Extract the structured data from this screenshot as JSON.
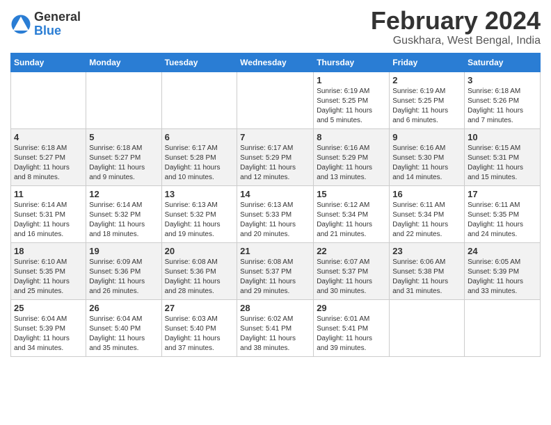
{
  "logo": {
    "general": "General",
    "blue": "Blue"
  },
  "header": {
    "title": "February 2024",
    "subtitle": "Guskhara, West Bengal, India"
  },
  "days_of_week": [
    "Sunday",
    "Monday",
    "Tuesday",
    "Wednesday",
    "Thursday",
    "Friday",
    "Saturday"
  ],
  "weeks": [
    [
      {
        "day": "",
        "info": ""
      },
      {
        "day": "",
        "info": ""
      },
      {
        "day": "",
        "info": ""
      },
      {
        "day": "",
        "info": ""
      },
      {
        "day": "1",
        "info": "Sunrise: 6:19 AM\nSunset: 5:25 PM\nDaylight: 11 hours\nand 5 minutes."
      },
      {
        "day": "2",
        "info": "Sunrise: 6:19 AM\nSunset: 5:25 PM\nDaylight: 11 hours\nand 6 minutes."
      },
      {
        "day": "3",
        "info": "Sunrise: 6:18 AM\nSunset: 5:26 PM\nDaylight: 11 hours\nand 7 minutes."
      }
    ],
    [
      {
        "day": "4",
        "info": "Sunrise: 6:18 AM\nSunset: 5:27 PM\nDaylight: 11 hours\nand 8 minutes."
      },
      {
        "day": "5",
        "info": "Sunrise: 6:18 AM\nSunset: 5:27 PM\nDaylight: 11 hours\nand 9 minutes."
      },
      {
        "day": "6",
        "info": "Sunrise: 6:17 AM\nSunset: 5:28 PM\nDaylight: 11 hours\nand 10 minutes."
      },
      {
        "day": "7",
        "info": "Sunrise: 6:17 AM\nSunset: 5:29 PM\nDaylight: 11 hours\nand 12 minutes."
      },
      {
        "day": "8",
        "info": "Sunrise: 6:16 AM\nSunset: 5:29 PM\nDaylight: 11 hours\nand 13 minutes."
      },
      {
        "day": "9",
        "info": "Sunrise: 6:16 AM\nSunset: 5:30 PM\nDaylight: 11 hours\nand 14 minutes."
      },
      {
        "day": "10",
        "info": "Sunrise: 6:15 AM\nSunset: 5:31 PM\nDaylight: 11 hours\nand 15 minutes."
      }
    ],
    [
      {
        "day": "11",
        "info": "Sunrise: 6:14 AM\nSunset: 5:31 PM\nDaylight: 11 hours\nand 16 minutes."
      },
      {
        "day": "12",
        "info": "Sunrise: 6:14 AM\nSunset: 5:32 PM\nDaylight: 11 hours\nand 18 minutes."
      },
      {
        "day": "13",
        "info": "Sunrise: 6:13 AM\nSunset: 5:32 PM\nDaylight: 11 hours\nand 19 minutes."
      },
      {
        "day": "14",
        "info": "Sunrise: 6:13 AM\nSunset: 5:33 PM\nDaylight: 11 hours\nand 20 minutes."
      },
      {
        "day": "15",
        "info": "Sunrise: 6:12 AM\nSunset: 5:34 PM\nDaylight: 11 hours\nand 21 minutes."
      },
      {
        "day": "16",
        "info": "Sunrise: 6:11 AM\nSunset: 5:34 PM\nDaylight: 11 hours\nand 22 minutes."
      },
      {
        "day": "17",
        "info": "Sunrise: 6:11 AM\nSunset: 5:35 PM\nDaylight: 11 hours\nand 24 minutes."
      }
    ],
    [
      {
        "day": "18",
        "info": "Sunrise: 6:10 AM\nSunset: 5:35 PM\nDaylight: 11 hours\nand 25 minutes."
      },
      {
        "day": "19",
        "info": "Sunrise: 6:09 AM\nSunset: 5:36 PM\nDaylight: 11 hours\nand 26 minutes."
      },
      {
        "day": "20",
        "info": "Sunrise: 6:08 AM\nSunset: 5:36 PM\nDaylight: 11 hours\nand 28 minutes."
      },
      {
        "day": "21",
        "info": "Sunrise: 6:08 AM\nSunset: 5:37 PM\nDaylight: 11 hours\nand 29 minutes."
      },
      {
        "day": "22",
        "info": "Sunrise: 6:07 AM\nSunset: 5:37 PM\nDaylight: 11 hours\nand 30 minutes."
      },
      {
        "day": "23",
        "info": "Sunrise: 6:06 AM\nSunset: 5:38 PM\nDaylight: 11 hours\nand 31 minutes."
      },
      {
        "day": "24",
        "info": "Sunrise: 6:05 AM\nSunset: 5:39 PM\nDaylight: 11 hours\nand 33 minutes."
      }
    ],
    [
      {
        "day": "25",
        "info": "Sunrise: 6:04 AM\nSunset: 5:39 PM\nDaylight: 11 hours\nand 34 minutes."
      },
      {
        "day": "26",
        "info": "Sunrise: 6:04 AM\nSunset: 5:40 PM\nDaylight: 11 hours\nand 35 minutes."
      },
      {
        "day": "27",
        "info": "Sunrise: 6:03 AM\nSunset: 5:40 PM\nDaylight: 11 hours\nand 37 minutes."
      },
      {
        "day": "28",
        "info": "Sunrise: 6:02 AM\nSunset: 5:41 PM\nDaylight: 11 hours\nand 38 minutes."
      },
      {
        "day": "29",
        "info": "Sunrise: 6:01 AM\nSunset: 5:41 PM\nDaylight: 11 hours\nand 39 minutes."
      },
      {
        "day": "",
        "info": ""
      },
      {
        "day": "",
        "info": ""
      }
    ]
  ]
}
